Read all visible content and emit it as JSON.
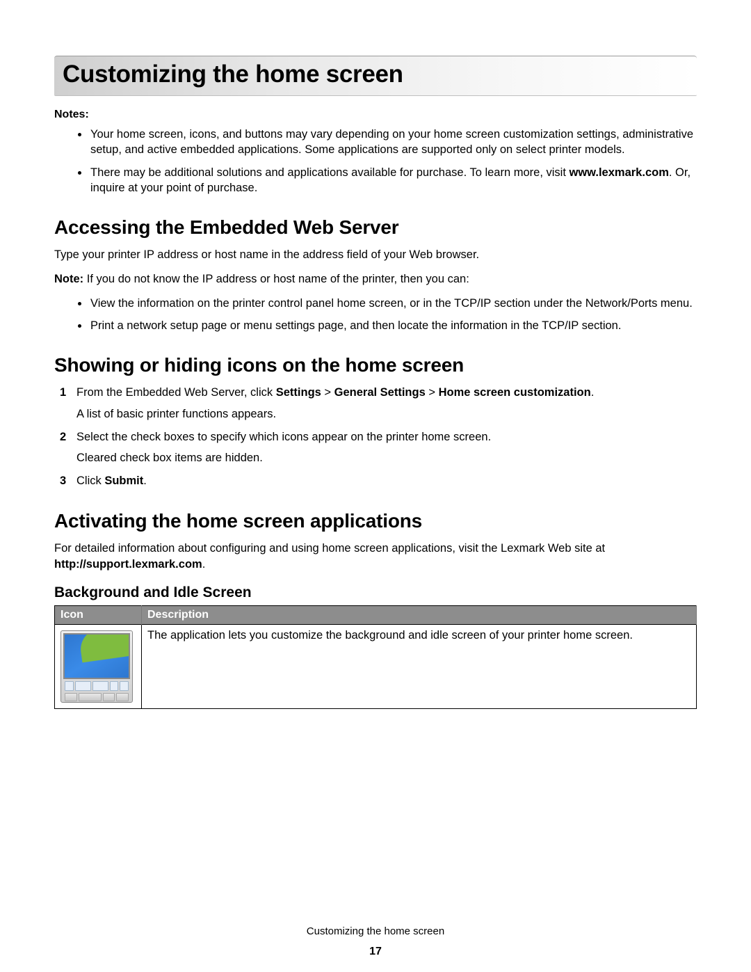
{
  "title": "Customizing the home screen",
  "notes_label": "Notes:",
  "notes": [
    "Your home screen, icons, and buttons may vary depending on your home screen customization settings, administrative setup, and active embedded applications. Some applications are supported only on select printer models.",
    {
      "pre": "There may be additional solutions and applications available for purchase. To learn more, visit ",
      "bold": "www.lexmark.com",
      "post": ". Or, inquire at your point of purchase."
    }
  ],
  "section1": {
    "heading": "Accessing the Embedded Web Server",
    "intro": "Type your printer IP address or host name in the address field of your Web browser.",
    "note_prefix": "Note:",
    "note_text": " If you do not know the IP address or host name of the printer, then you can:",
    "bullets": [
      "View the information on the printer control panel home screen, or in the TCP/IP section under the Network/Ports menu.",
      "Print a network setup page or menu settings page, and then locate the information in the TCP/IP section."
    ]
  },
  "section2": {
    "heading": "Showing or hiding icons on the home screen",
    "steps": [
      {
        "pre": "From the Embedded Web Server, click ",
        "b1": "Settings",
        "g1": " > ",
        "b2": "General Settings",
        "g2": " > ",
        "b3": "Home screen customization",
        "post": ".",
        "sub": "A list of basic printer functions appears."
      },
      {
        "text": "Select the check boxes to specify which icons appear on the printer home screen.",
        "sub": "Cleared check box items are hidden."
      },
      {
        "pre": "Click ",
        "b1": "Submit",
        "post": "."
      }
    ]
  },
  "section3": {
    "heading": "Activating the home screen applications",
    "intro_pre": "For detailed information about configuring and using home screen applications, visit the Lexmark Web site at ",
    "intro_bold": "http://support.lexmark.com",
    "intro_post": ".",
    "sub_heading": "Background and Idle Screen",
    "table": {
      "th_icon": "Icon",
      "th_desc": "Description",
      "desc": "The application lets you customize the background and idle screen of your printer home screen."
    }
  },
  "footer_text": "Customizing the home screen",
  "page_number": "17"
}
